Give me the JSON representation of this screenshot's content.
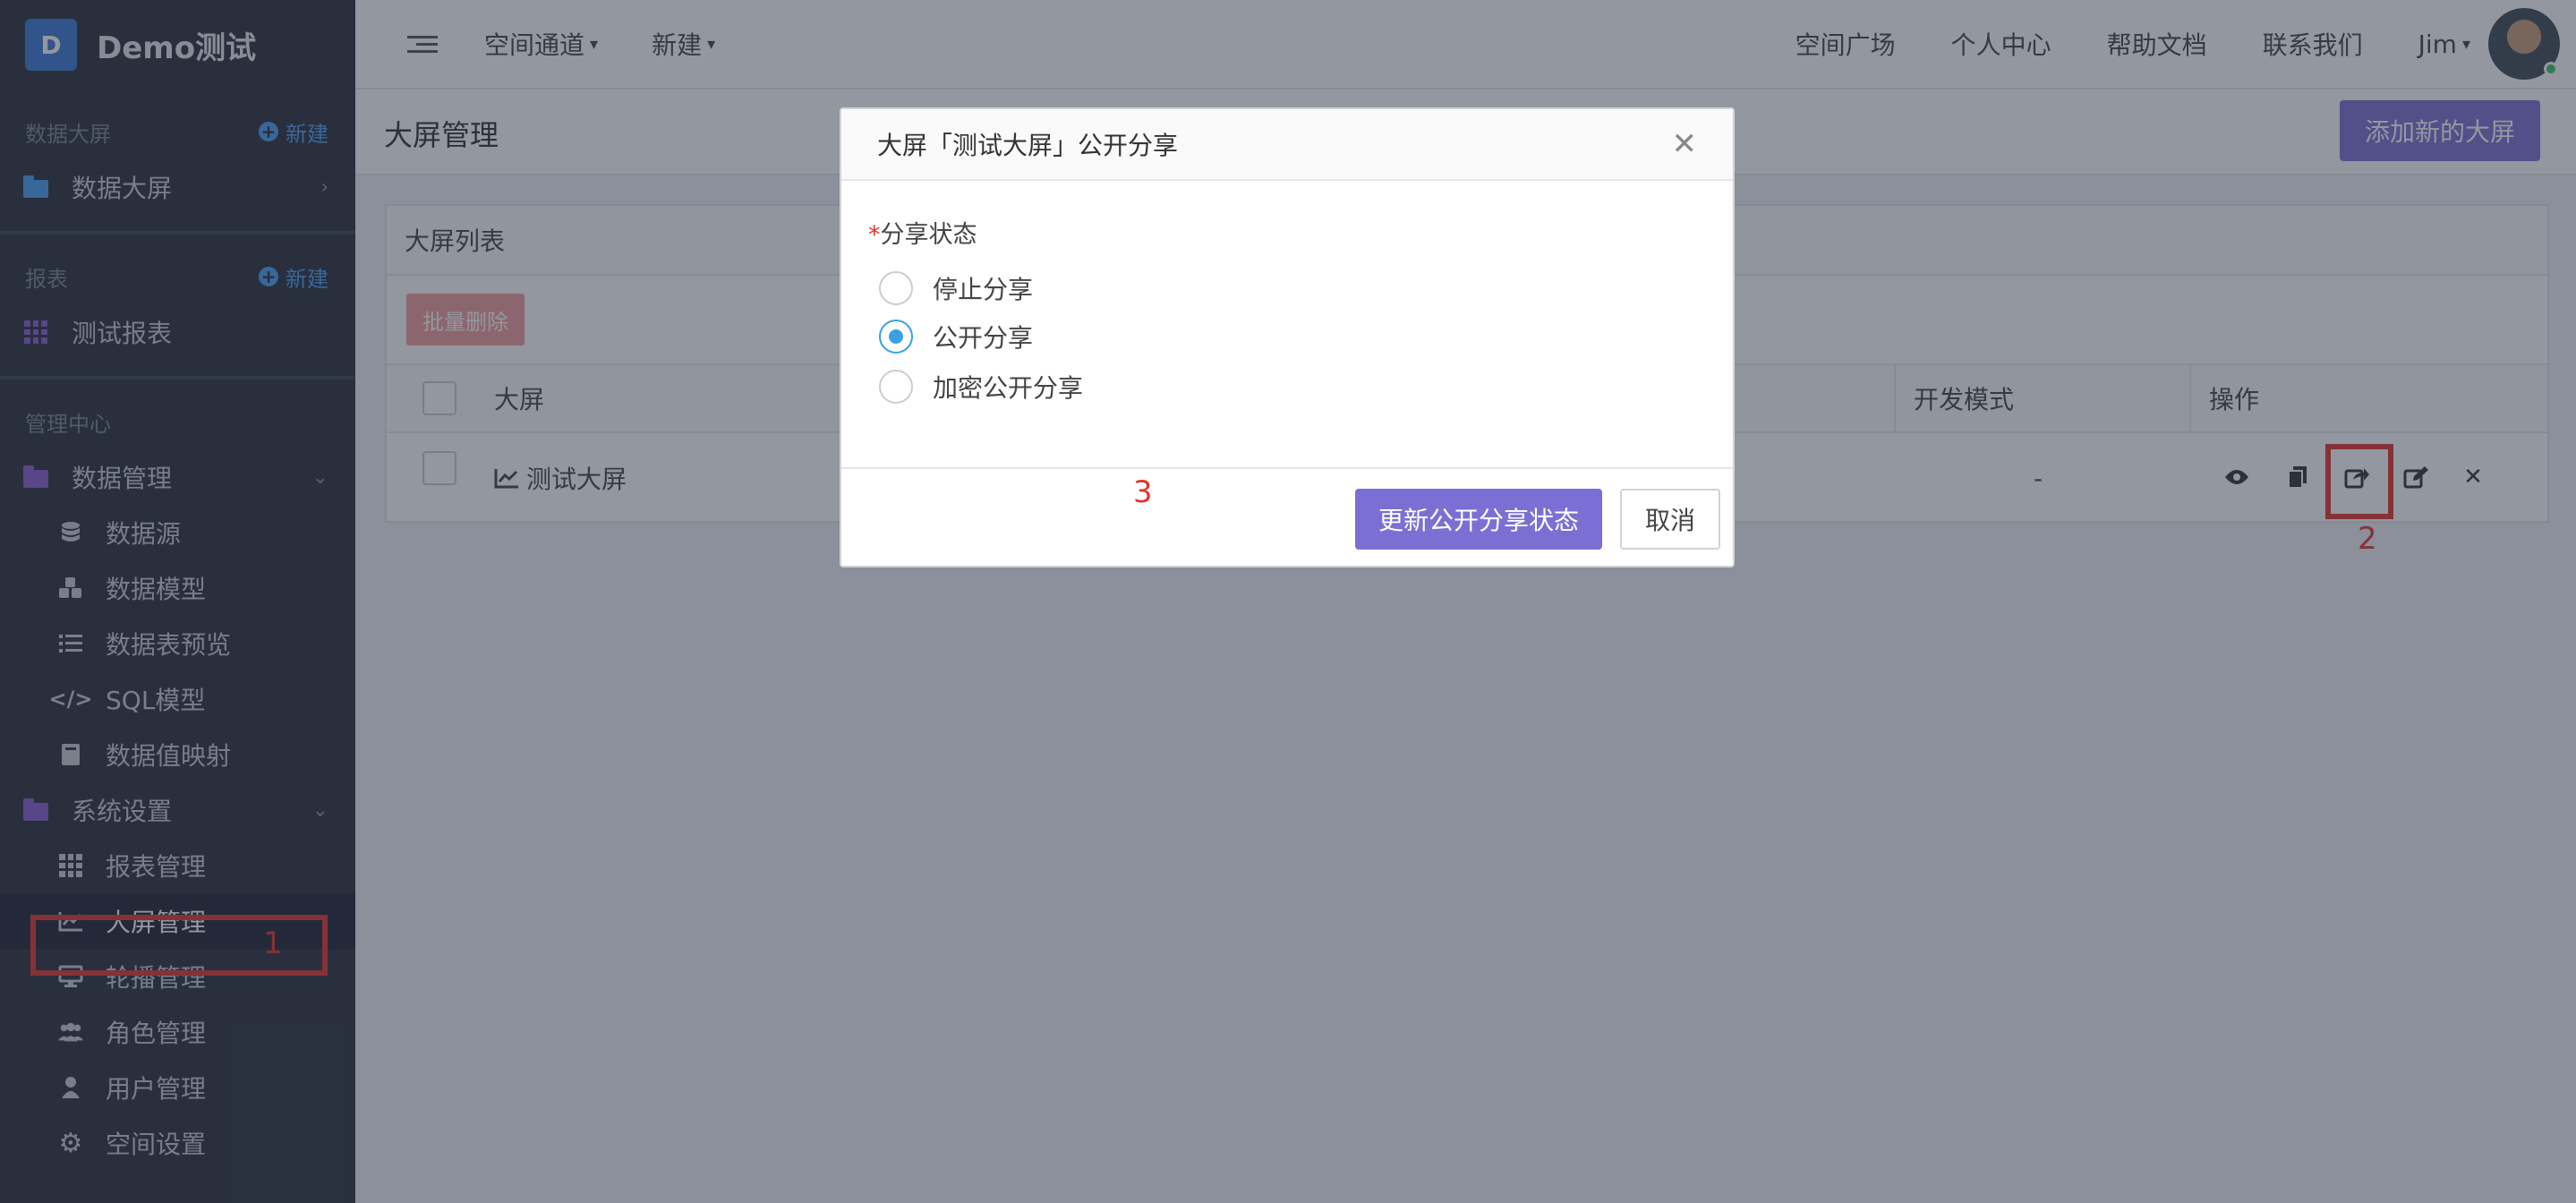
{
  "brand": {
    "logo_letter": "D",
    "name": "Demo测试"
  },
  "sidebar": {
    "sections": [
      {
        "title": "数据大屏",
        "new_label": "新建"
      },
      {
        "title": "报表",
        "new_label": "新建"
      },
      {
        "title": "管理中心"
      }
    ],
    "data_screen": "数据大屏",
    "report": "测试报表",
    "data_mgmt": "数据管理",
    "data_items": [
      "数据源",
      "数据模型",
      "数据表预览",
      "SQL模型",
      "数据值映射"
    ],
    "system": "系统设置",
    "system_items": [
      "报表管理",
      "大屏管理",
      "轮播管理",
      "角色管理",
      "用户管理",
      "空间设置"
    ]
  },
  "topbar": {
    "space_channel": "空间通道",
    "new": "新建",
    "right_links": [
      "空间广场",
      "个人中心",
      "帮助文档",
      "联系我们"
    ],
    "user": "Jim"
  },
  "page": {
    "title": "大屏管理",
    "add_button": "添加新的大屏",
    "panel_title": "大屏列表",
    "batch_delete": "批量删除",
    "columns": {
      "name": "大屏",
      "dev_mode": "开发模式",
      "actions": "操作"
    },
    "row": {
      "name": "测试大屏",
      "dev_mode": "-"
    }
  },
  "modal": {
    "title": "大屏「测试大屏」公开分享",
    "required_mark": "*",
    "field_label": "分享状态",
    "options": [
      "停止分享",
      "公开分享",
      "加密公开分享"
    ],
    "selected": "公开分享",
    "confirm": "更新公开分享状态",
    "cancel": "取消"
  },
  "annotations": [
    "1",
    "2",
    "3"
  ],
  "colors": {
    "accent": "#7c6fd3",
    "annotation": "#e3342f",
    "sidebar_bg": "#2b2f3b"
  }
}
